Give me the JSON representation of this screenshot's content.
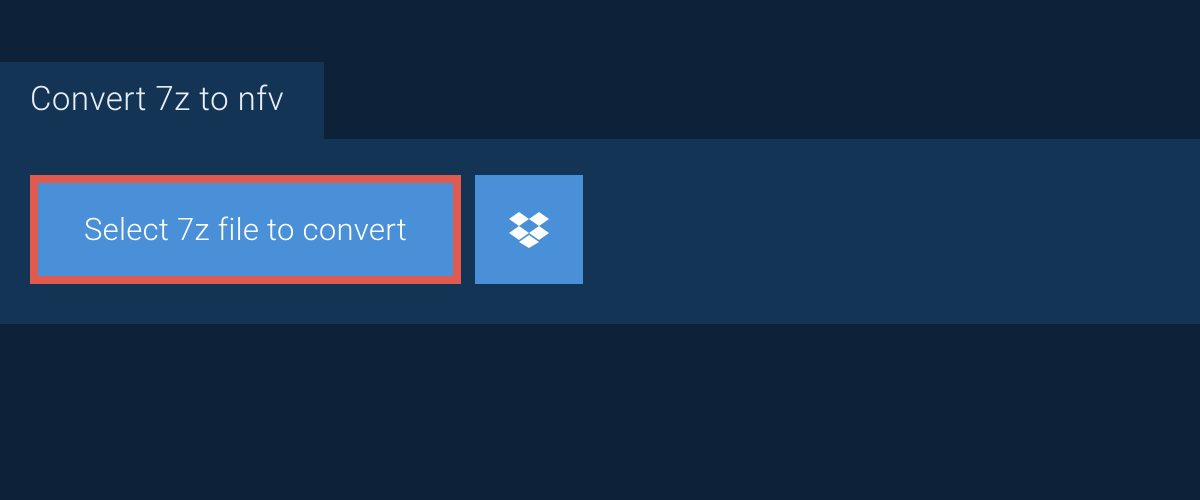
{
  "header": {
    "tab_label": "Convert 7z to nfv"
  },
  "actions": {
    "select_file_label": "Select 7z file to convert",
    "cloud_provider_icon": "dropbox-icon"
  },
  "colors": {
    "background": "#0d2238",
    "panel": "#143455",
    "button": "#4a90d9",
    "highlight_border": "#e05a4f",
    "text_light": "#ffffff"
  }
}
